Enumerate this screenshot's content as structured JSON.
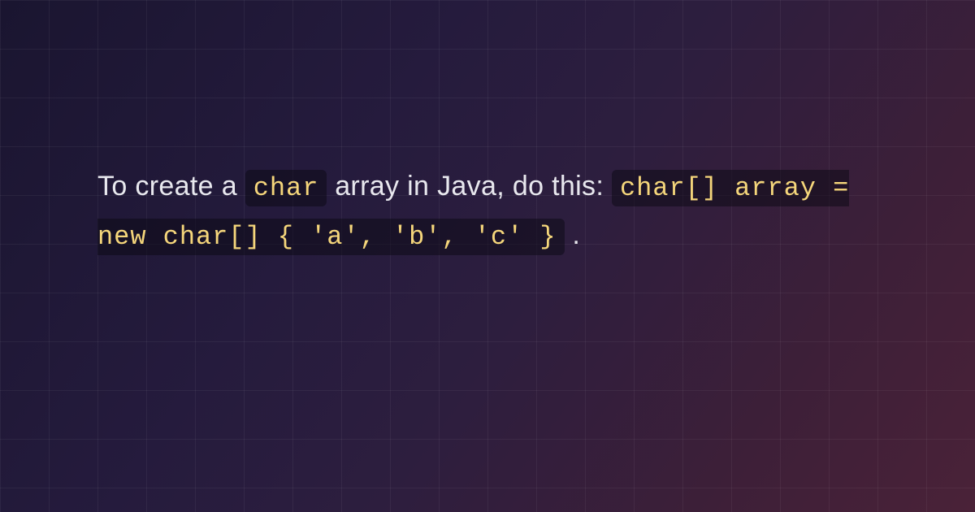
{
  "content": {
    "text_before_inline_code": "To create a ",
    "inline_code": "char",
    "text_after_inline_code": " array in Java, do this: ",
    "code_block": "char[] array = new char[] { 'a', 'b', 'c' }",
    "text_after_code_block": "."
  },
  "colors": {
    "code_highlight": "#f5d67b",
    "code_background": "rgba(10,8,18,0.5)",
    "text": "#e8e8ee"
  }
}
